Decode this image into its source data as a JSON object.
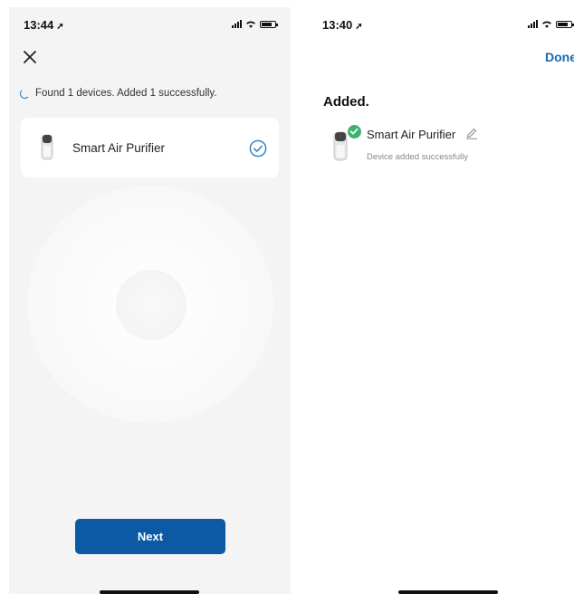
{
  "left_screen": {
    "status_bar": {
      "time": "13:44"
    },
    "found_text": "Found 1 devices. Added 1 successfully.",
    "device": {
      "name": "Smart Air Purifier"
    },
    "next_label": "Next"
  },
  "right_screen": {
    "status_bar": {
      "time": "13:40"
    },
    "done_label": "Done",
    "section_title": "Added.",
    "device": {
      "name": "Smart Air Purifier",
      "status": "Device added successfully"
    }
  },
  "colors": {
    "primary_button": "#0b5aa3",
    "link": "#1769b0",
    "success": "#3cb26d",
    "accent": "#2a7bc4"
  },
  "icons": [
    "close-icon",
    "loading-spinner-icon",
    "air-purifier-icon",
    "check-circle-icon",
    "checkmark-badge-icon",
    "pencil-icon",
    "location-arrow-icon",
    "signal-icon",
    "wifi-icon",
    "battery-icon"
  ]
}
